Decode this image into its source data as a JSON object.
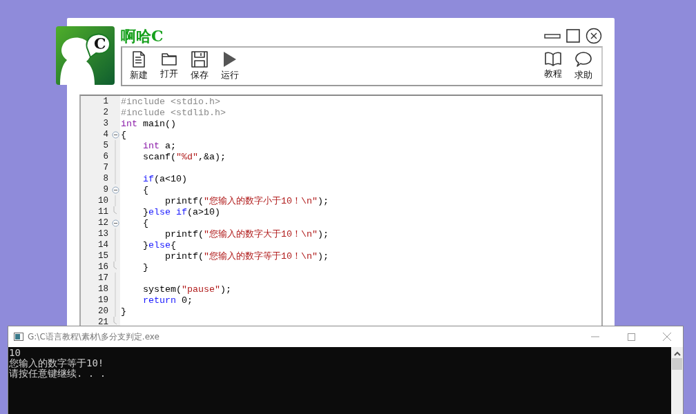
{
  "app": {
    "title": "啊哈C",
    "logo_letter": "C"
  },
  "toolbar": {
    "left": [
      {
        "label": "新建"
      },
      {
        "label": "打开"
      },
      {
        "label": "保存"
      },
      {
        "label": "运行"
      }
    ],
    "right": [
      {
        "label": "教程"
      },
      {
        "label": "求助"
      }
    ]
  },
  "editor": {
    "lines": [
      {
        "number": "1",
        "fold_start": false,
        "fold_end": false,
        "tokens": [
          {
            "kind": "pp",
            "text": "#include <stdio.h>"
          }
        ]
      },
      {
        "number": "2",
        "fold_start": false,
        "fold_end": false,
        "tokens": [
          {
            "kind": "pp",
            "text": "#include <stdlib.h>"
          }
        ]
      },
      {
        "number": "3",
        "fold_start": false,
        "fold_end": false,
        "tokens": [
          {
            "kind": "type",
            "text": "int"
          },
          {
            "kind": "plain",
            "text": " main()"
          }
        ]
      },
      {
        "number": "4",
        "fold_start": true,
        "fold_end": false,
        "tokens": [
          {
            "kind": "plain",
            "text": "{"
          }
        ]
      },
      {
        "number": "5",
        "fold_start": false,
        "fold_end": false,
        "tokens": [
          {
            "kind": "type",
            "text": "    int"
          },
          {
            "kind": "plain",
            "text": " a;"
          }
        ]
      },
      {
        "number": "6",
        "fold_start": false,
        "fold_end": false,
        "tokens": [
          {
            "kind": "plain",
            "text": "    scanf("
          },
          {
            "kind": "str",
            "text": "\"%d\""
          },
          {
            "kind": "plain",
            "text": ",&a);"
          }
        ]
      },
      {
        "number": "7",
        "fold_start": false,
        "fold_end": false
      },
      {
        "number": "8",
        "fold_start": false,
        "fold_end": false,
        "tokens": [
          {
            "kind": "kw",
            "text": "    if"
          },
          {
            "kind": "plain",
            "text": "(a<10)"
          }
        ]
      },
      {
        "number": "9",
        "fold_start": true,
        "fold_end": false,
        "tokens": [
          {
            "kind": "plain",
            "text": "    {"
          }
        ]
      },
      {
        "number": "10",
        "fold_start": false,
        "fold_end": false,
        "tokens": [
          {
            "kind": "plain",
            "text": "        printf("
          },
          {
            "kind": "str",
            "text": "\"您输入的数字小于10！\\n\""
          },
          {
            "kind": "plain",
            "text": ");"
          }
        ]
      },
      {
        "number": "11",
        "fold_start": false,
        "fold_end": true,
        "tokens": [
          {
            "kind": "plain",
            "text": "    }"
          },
          {
            "kind": "kw",
            "text": "else if"
          },
          {
            "kind": "plain",
            "text": "(a>10)"
          }
        ]
      },
      {
        "number": "12",
        "fold_start": true,
        "fold_end": false,
        "tokens": [
          {
            "kind": "plain",
            "text": "    {"
          }
        ]
      },
      {
        "number": "13",
        "fold_start": false,
        "fold_end": false,
        "tokens": [
          {
            "kind": "plain",
            "text": "        printf("
          },
          {
            "kind": "str",
            "text": "\"您输入的数字大于10！\\n\""
          },
          {
            "kind": "plain",
            "text": ");"
          }
        ]
      },
      {
        "number": "14",
        "fold_start": false,
        "fold_end": false,
        "tokens": [
          {
            "kind": "plain",
            "text": "    }"
          },
          {
            "kind": "kw",
            "text": "else"
          },
          {
            "kind": "plain",
            "text": "{"
          }
        ]
      },
      {
        "number": "15",
        "fold_start": false,
        "fold_end": false,
        "tokens": [
          {
            "kind": "plain",
            "text": "        printf("
          },
          {
            "kind": "str",
            "text": "\"您输入的数字等于10！\\n\""
          },
          {
            "kind": "plain",
            "text": ");"
          }
        ]
      },
      {
        "number": "16",
        "fold_start": false,
        "fold_end": true,
        "tokens": [
          {
            "kind": "plain",
            "text": "    }"
          }
        ]
      },
      {
        "number": "17",
        "fold_start": false,
        "fold_end": false
      },
      {
        "number": "18",
        "fold_start": false,
        "fold_end": false,
        "tokens": [
          {
            "kind": "plain",
            "text": "    system("
          },
          {
            "kind": "str",
            "text": "\"pause\""
          },
          {
            "kind": "plain",
            "text": ");"
          }
        ]
      },
      {
        "number": "19",
        "fold_start": false,
        "fold_end": false,
        "tokens": [
          {
            "kind": "kw",
            "text": "    return"
          },
          {
            "kind": "plain",
            "text": " 0;"
          }
        ]
      },
      {
        "number": "20",
        "fold_start": false,
        "fold_end": false,
        "tokens": [
          {
            "kind": "plain",
            "text": "}"
          }
        ]
      },
      {
        "number": "21",
        "fold_start": false,
        "fold_end": true
      }
    ]
  },
  "console": {
    "title": "G:\\C语言教程\\素材\\多分支判定.exe",
    "output": [
      "10",
      "您输入的数字等于10!",
      "请按任意键继续. . ."
    ]
  }
}
